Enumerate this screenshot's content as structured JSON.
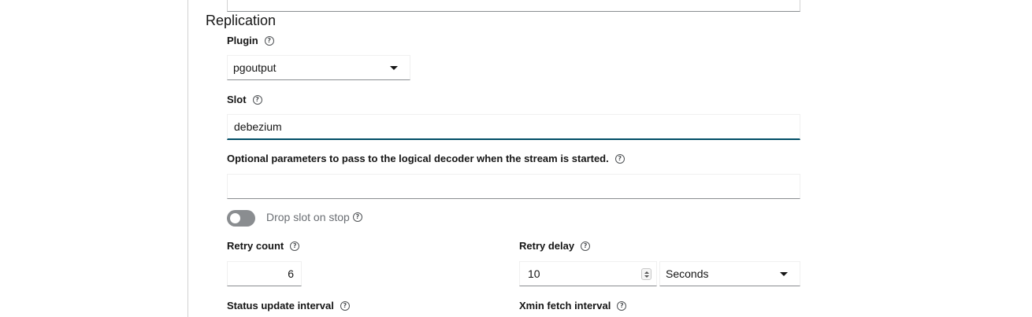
{
  "section": {
    "title": "Replication"
  },
  "plugin": {
    "label": "Plugin",
    "value": "pgoutput"
  },
  "slot": {
    "label": "Slot",
    "value": "debezium"
  },
  "decoder_params": {
    "label": "Optional parameters to pass to the logical decoder when the stream is started.",
    "value": ""
  },
  "drop_slot": {
    "label": "Drop slot on stop",
    "enabled": false
  },
  "retry_count": {
    "label": "Retry count",
    "value": "6"
  },
  "retry_delay": {
    "label": "Retry delay",
    "value": "10",
    "unit": "Seconds"
  },
  "status_update": {
    "label": "Status update interval"
  },
  "xmin_fetch": {
    "label": "Xmin fetch interval"
  },
  "icons": {
    "help": "help-circle-icon",
    "dropdown": "caret-down-icon"
  },
  "colors": {
    "focus_border": "#004d66",
    "toggle_off": "#8a8d90"
  }
}
